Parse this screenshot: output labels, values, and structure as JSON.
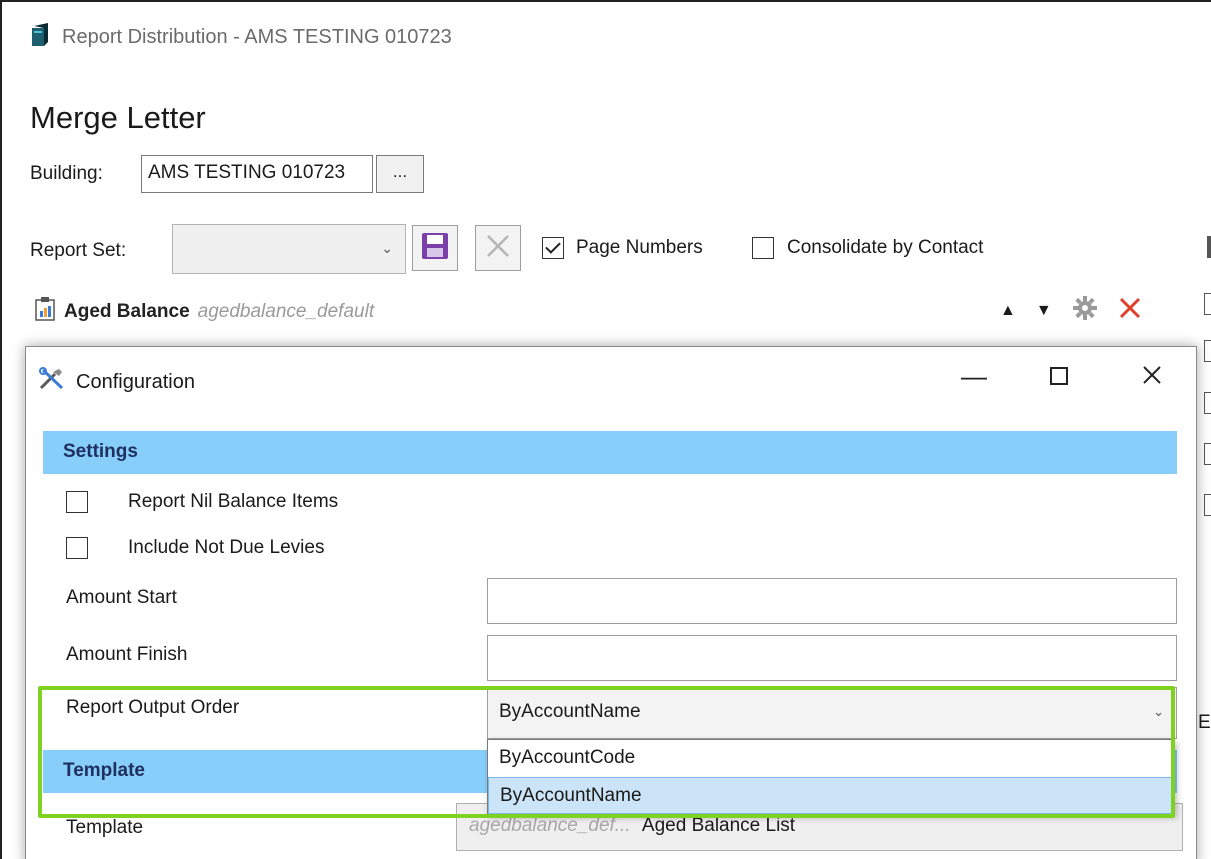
{
  "window": {
    "title": "Report Distribution - AMS TESTING 010723"
  },
  "page": {
    "title": "Merge Letter"
  },
  "building": {
    "label": "Building:",
    "value": "AMS TESTING 010723",
    "browse_label": "..."
  },
  "report_set": {
    "label": "Report Set:",
    "value": ""
  },
  "options": {
    "page_numbers_label": "Page Numbers",
    "page_numbers_checked": true,
    "consolidate_label": "Consolidate by Contact",
    "consolidate_checked": false
  },
  "report_item": {
    "name": "Aged Balance",
    "template": "agedbalance_default"
  },
  "dialog": {
    "title": "Configuration",
    "settings_header": "Settings",
    "report_nil_label": "Report Nil Balance Items",
    "include_not_due_label": "Include Not Due Levies",
    "amount_start_label": "Amount Start",
    "amount_start_value": "",
    "amount_finish_label": "Amount Finish",
    "amount_finish_value": "",
    "output_order_label": "Report Output Order",
    "output_order_value": "ByAccountName",
    "output_order_options": [
      "ByAccountCode",
      "ByAccountName"
    ],
    "template_header": "Template",
    "template_label": "Template",
    "template_code": "agedbalance_def...",
    "template_name": "Aged Balance List"
  },
  "edge_text": "E",
  "colors": {
    "section_header_bg": "#87cefa",
    "highlight_border": "#7ed321",
    "delete_red": "#e0402a",
    "save_purple": "#7a3fa8"
  }
}
